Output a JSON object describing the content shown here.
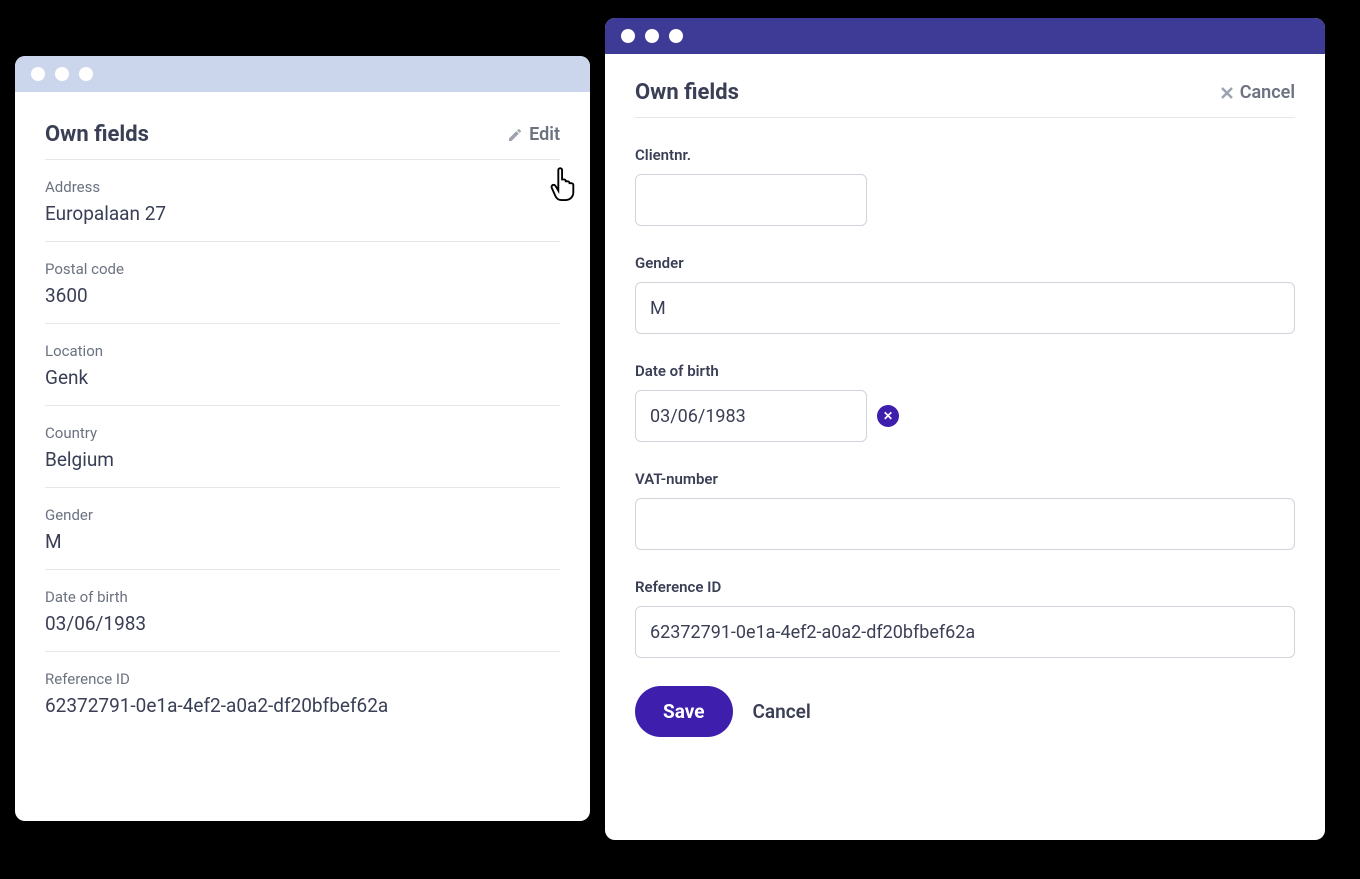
{
  "left_panel": {
    "title": "Own fields",
    "edit_label": "Edit",
    "fields": [
      {
        "label": "Address",
        "value": "Europalaan 27"
      },
      {
        "label": "Postal code",
        "value": "3600"
      },
      {
        "label": "Location",
        "value": "Genk"
      },
      {
        "label": "Country",
        "value": "Belgium"
      },
      {
        "label": "Gender",
        "value": "M"
      },
      {
        "label": "Date of birth",
        "value": "03/06/1983"
      },
      {
        "label": "Reference ID",
        "value": "62372791-0e1a-4ef2-a0a2-df20bfbef62a"
      }
    ]
  },
  "right_panel": {
    "title": "Own fields",
    "cancel_label": "Cancel",
    "form": {
      "clientnr": {
        "label": "Clientnr.",
        "value": ""
      },
      "gender": {
        "label": "Gender",
        "value": "M"
      },
      "date_of_birth": {
        "label": "Date of birth",
        "value": "03/06/1983"
      },
      "vat_number": {
        "label": "VAT-number",
        "value": ""
      },
      "reference_id": {
        "label": "Reference ID",
        "value": "62372791-0e1a-4ef2-a0a2-df20bfbef62a"
      }
    },
    "buttons": {
      "save": "Save",
      "cancel": "Cancel"
    }
  }
}
